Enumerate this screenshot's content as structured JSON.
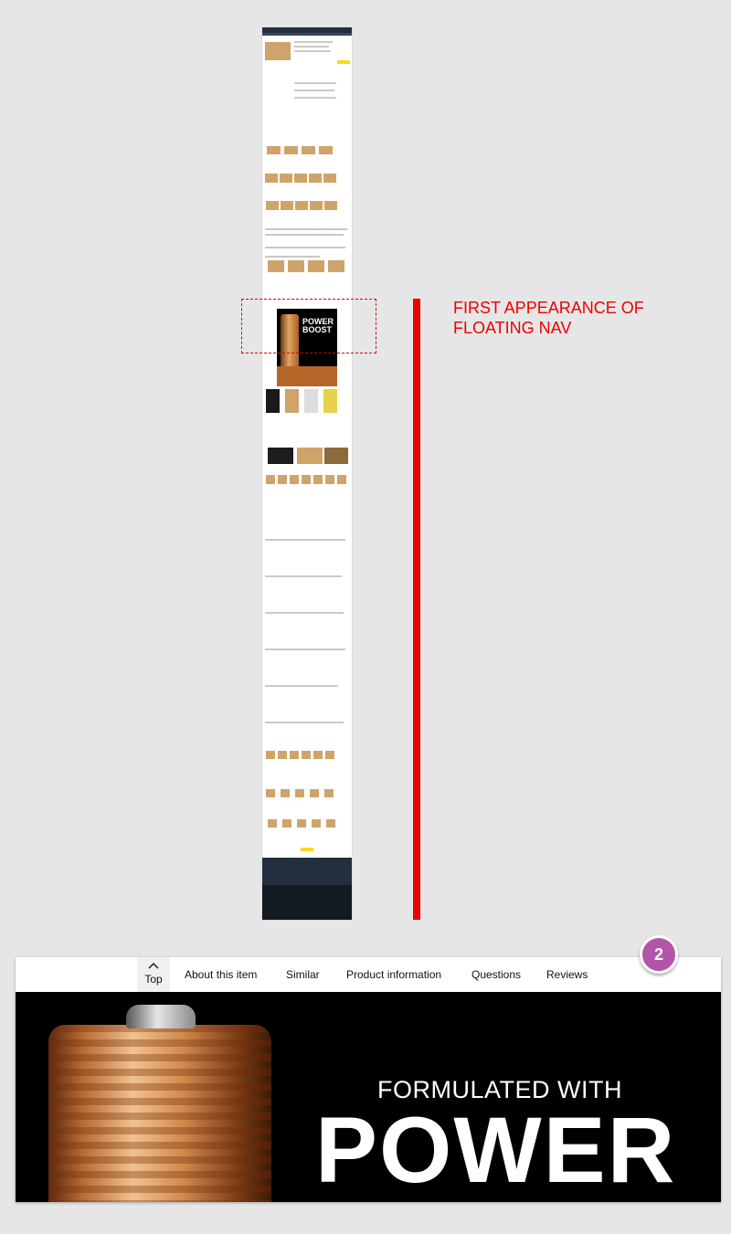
{
  "annotation": {
    "label": "FIRST APPEARANCE OF FLOATING NAV",
    "badge": "2"
  },
  "thumbnail": {
    "ad_line1": "POWER",
    "ad_line2": "BOOST"
  },
  "floating_nav": {
    "top_label": "Top",
    "items": [
      {
        "label": "About this item"
      },
      {
        "label": "Similar"
      },
      {
        "label": "Product information"
      },
      {
        "label": "Questions"
      },
      {
        "label": "Reviews"
      }
    ]
  },
  "hero": {
    "line1": "FORMULATED WITH",
    "line2": "POWER"
  },
  "colors": {
    "annotation_red": "#ee0000",
    "badge": "#b155a8",
    "amazon_header": "#232f3e"
  }
}
